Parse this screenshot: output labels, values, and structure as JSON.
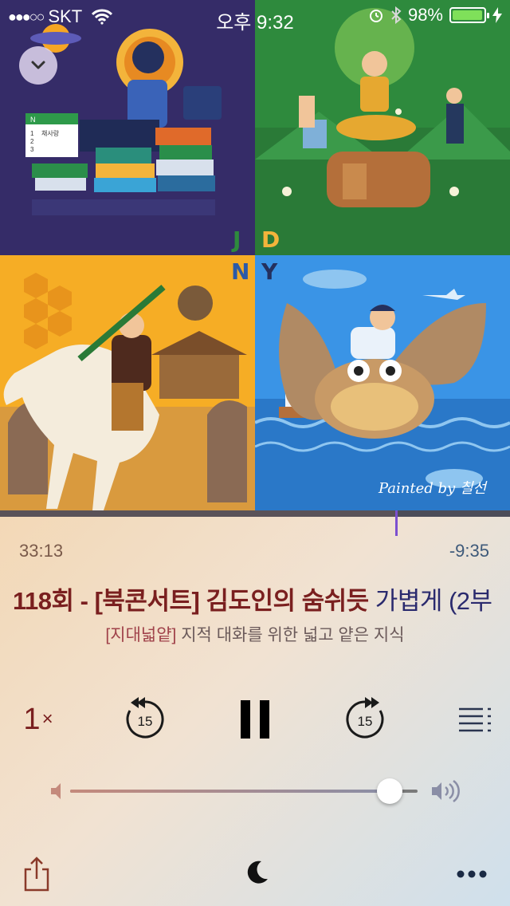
{
  "status_bar": {
    "signal": "●●●○○",
    "carrier": "SKT",
    "time": "오후 9:32",
    "battery": "98%",
    "battery_level": 0.98
  },
  "artwork": {
    "letters": [
      "J",
      "D",
      "N",
      "Y"
    ],
    "q1_book_list": [
      "N",
      "1",
      "2",
      "3",
      "채사랑"
    ],
    "painted_by": "Painted by 칠선"
  },
  "player": {
    "elapsed": "33:13",
    "remaining": "-9:35",
    "progress": 0.776,
    "episode_title_main": "118회 - [북콘서트] 김도인의 숨쉬듯",
    "episode_title_tail": "가볍게 (2부",
    "podcast_tag": "[지대넓얕]",
    "podcast_name": "지적 대화를 위한 넓고 얕은 지식",
    "speed_value": "1",
    "speed_suffix": "×",
    "skip_back_seconds": "15",
    "skip_forward_seconds": "15",
    "volume": 0.92
  },
  "colors": {
    "title_red": "#7a1f1f",
    "title_navy": "#2a2a6e",
    "scrubber": "#7c4fcf"
  },
  "icons": [
    "chevron-down-icon",
    "wifi-icon",
    "alarm-icon",
    "bluetooth-icon",
    "charging-icon",
    "rewind-15-icon",
    "pause-icon",
    "forward-15-icon",
    "queue-list-icon",
    "volume-low-icon",
    "volume-high-icon",
    "share-icon",
    "sleep-moon-icon",
    "more-icon"
  ]
}
